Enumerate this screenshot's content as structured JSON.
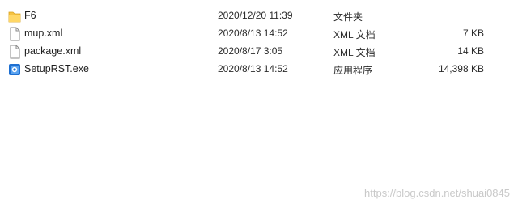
{
  "files": [
    {
      "name": "F6",
      "date": "2020/12/20 11:39",
      "type": "文件夹",
      "size": "",
      "icon": "folder-icon"
    },
    {
      "name": "mup.xml",
      "date": "2020/8/13 14:52",
      "type": "XML 文档",
      "size": "7 KB",
      "icon": "document-icon"
    },
    {
      "name": "package.xml",
      "date": "2020/8/17 3:05",
      "type": "XML 文档",
      "size": "14 KB",
      "icon": "document-icon"
    },
    {
      "name": "SetupRST.exe",
      "date": "2020/8/13 14:52",
      "type": "应用程序",
      "size": "14,398 KB",
      "icon": "installer-icon"
    }
  ],
  "watermark": "https://blog.csdn.net/shuai0845",
  "colors": {
    "folder": "#f6c343",
    "accent": "#1e6fd1"
  }
}
